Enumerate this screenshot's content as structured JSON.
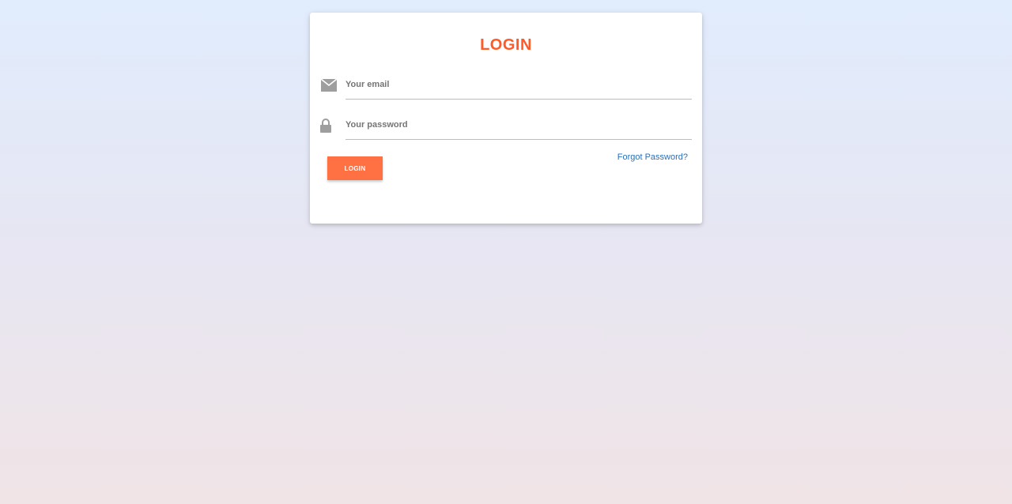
{
  "login_form": {
    "title": "LOGIN",
    "email_placeholder": "Your email",
    "email_value": "",
    "password_placeholder": "Your password",
    "password_value": "",
    "submit_label": "LOGIN",
    "forgot_password_label": "Forgot Password?"
  },
  "icons": {
    "email": "envelope-icon",
    "password": "lock-icon"
  },
  "colors": {
    "accent": "#ff5a27",
    "button": "#ff7043",
    "link": "#2a6fb8",
    "icon": "#9e9e9e"
  }
}
